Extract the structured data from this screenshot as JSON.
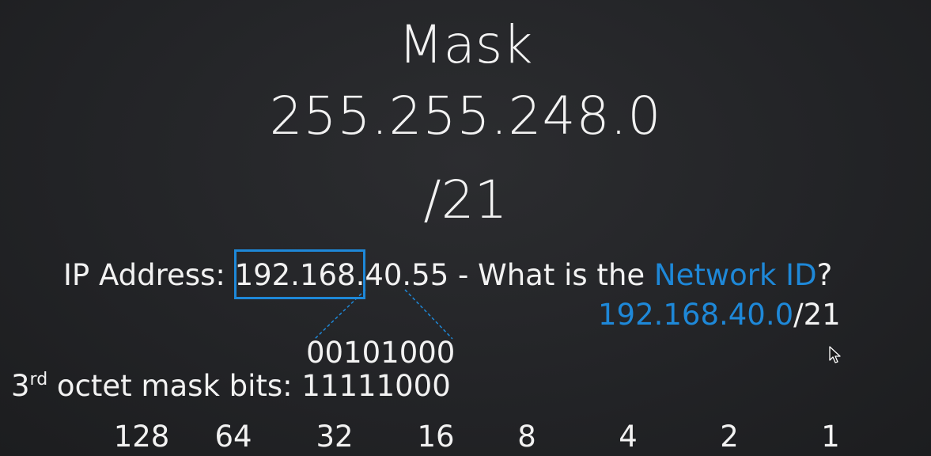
{
  "slide": {
    "title": "Mask",
    "mask_value": "255.255.248.0",
    "cidr": "/21",
    "question": {
      "prefix": "IP Address: ",
      "ip_highlighted": "192.168.",
      "ip_rest": "40.55",
      "middle": " - What is the ",
      "keyword": "Network ID",
      "suffix": "?"
    },
    "answer": {
      "network_id": "192.168.40.0",
      "cidr": "/21"
    },
    "binary_octet": "00101000",
    "mask_bits": {
      "ordinal_prefix": "3",
      "ordinal_suffix": "rd",
      "label": " octet mask bits: ",
      "value": "11111000"
    },
    "bit_values": [
      "128",
      "64",
      "32",
      "16",
      "8",
      "4",
      "2",
      "1"
    ]
  },
  "colors": {
    "accent": "#1e88d8",
    "text": "#f2f2f2",
    "background": "#232427"
  }
}
